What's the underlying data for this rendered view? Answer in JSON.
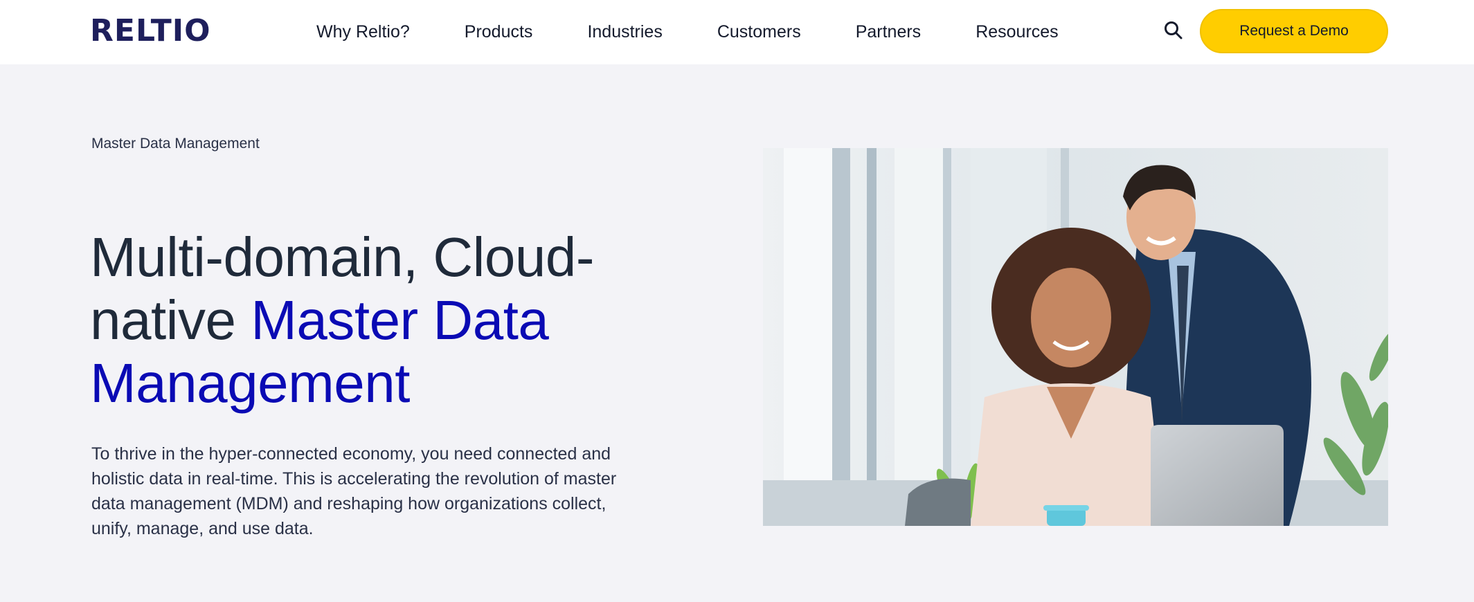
{
  "header": {
    "logo": "RELTIO",
    "nav": [
      "Why Reltio?",
      "Products",
      "Industries",
      "Customers",
      "Partners",
      "Resources"
    ],
    "search_icon": "search-icon",
    "cta": "Request a Demo",
    "colors": {
      "cta_bg": "#ffcd00",
      "logo": "#1e1f5c"
    }
  },
  "hero": {
    "eyebrow": "Master Data Management",
    "headline_part1": "Multi-domain, Cloud-native ",
    "headline_part2": "Master Data Management",
    "lead": "To thrive in the hyper-connected economy, you need connected and holistic data in real-time. This is accelerating the revolution of master data management (MDM) and reshaping how organizations collect, unify, manage, and use data.",
    "colors": {
      "accent": "#0a0ab4",
      "text": "#1f2a3a",
      "background": "#f3f3f7"
    }
  }
}
